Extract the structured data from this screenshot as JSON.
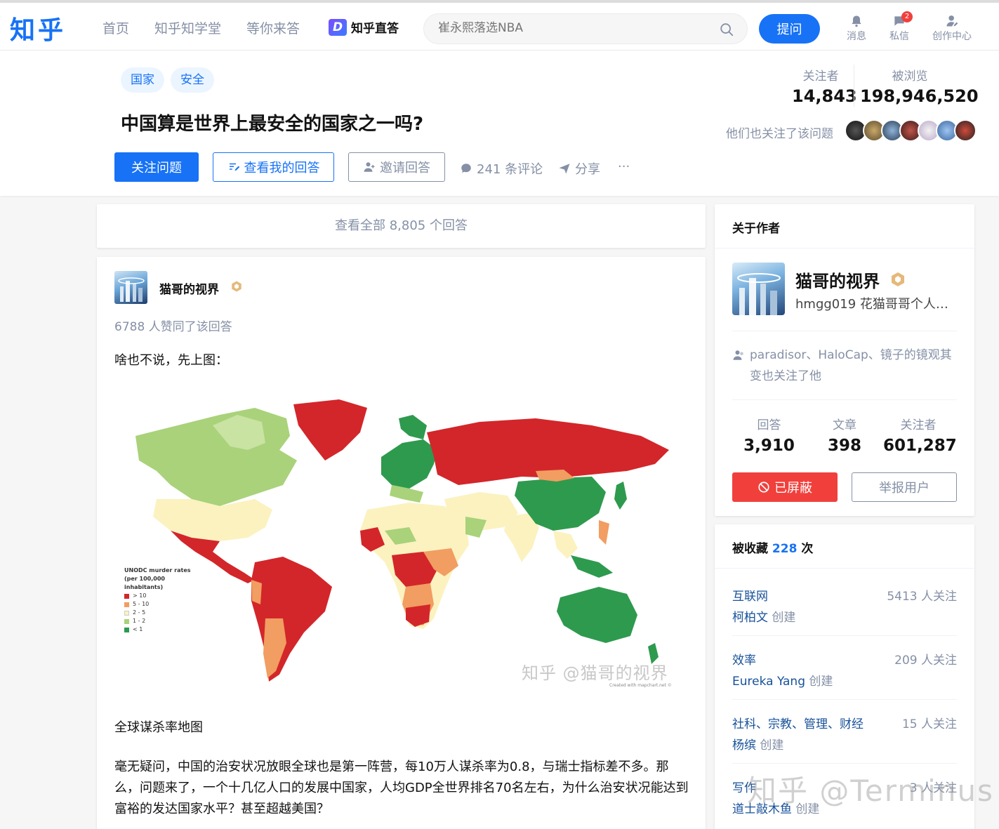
{
  "header": {
    "logo": "知乎",
    "nav": [
      "首页",
      "知乎知学堂",
      "等你来答"
    ],
    "zhida_icon": "D",
    "zhida_label": "知乎直答",
    "search_placeholder": "崔永熙落选NBA",
    "ask_label": "提问",
    "icons": [
      {
        "label": "消息",
        "icon": "bell-icon"
      },
      {
        "label": "私信",
        "icon": "chat-icon",
        "badge": "2"
      },
      {
        "label": "创作中心",
        "icon": "creator-icon"
      }
    ]
  },
  "question": {
    "tags": [
      "国家",
      "安全"
    ],
    "title": "中国算是世界上最安全的国家之一吗?",
    "follow_label": "关注问题",
    "my_answer_label": "查看我的回答",
    "invite_label": "邀请回答",
    "comments_label": "241 条评论",
    "share_label": "分享",
    "more_label": "···",
    "followers_label": "关注者",
    "followers_value": "14,843",
    "views_label": "被浏览",
    "views_value": "198,946,520",
    "also_follow_label": "他们也关注了该问题"
  },
  "main": {
    "view_all_label": "查看全部 8,805 个回答",
    "answer": {
      "author_name": "猫哥的视界",
      "votes": "6788 人赞同了该回答",
      "intro": "啥也不说，先上图：",
      "map_watermark": "知乎 @猫哥的视界",
      "map_credit": "Created with mapchart.net ©",
      "legend_title": "UNODC murder rates (per 100,000 inhabitants)",
      "legend": [
        {
          "label": "> 10",
          "color": "#d3262a"
        },
        {
          "label": "5 - 10",
          "color": "#f29d61"
        },
        {
          "label": "2 - 5",
          "color": "#fbf2c0"
        },
        {
          "label": "1 - 2",
          "color": "#a9d27a"
        },
        {
          "label": "< 1",
          "color": "#2e9a4e"
        }
      ],
      "caption": "全球谋杀率地图",
      "body": "毫无疑问，中国的治安状况放眼全球也是第一阵营，每10万人谋杀率为0.8，与瑞士指标差不多。那么，问题来了，一个十几亿人口的发展中国家，人均GDP全世界排名70名左右，为什么治安状况能达到富裕的发达国家水平？甚至超越美国？"
    }
  },
  "sidebar": {
    "about_title": "关于作者",
    "author_name": "猫哥的视界",
    "author_bio": "hmgg019 花猫哥哥个人好...",
    "also_follow": "paradisor、HaloCap、镜子的镜观其变也关注了他",
    "stats": [
      {
        "label": "回答",
        "value": "3,910"
      },
      {
        "label": "文章",
        "value": "398"
      },
      {
        "label": "关注者",
        "value": "601,287"
      }
    ],
    "blocked_label": "已屏蔽",
    "report_label": "举报用户",
    "collected_prefix": "被收藏",
    "collected_count": "228",
    "collected_suffix": "次",
    "collections": [
      {
        "name": "互联网",
        "count": "5413 人关注",
        "creator": "柯柏文",
        "suffix": "创建"
      },
      {
        "name": "效率",
        "count": "209 人关注",
        "creator": "Eureka Yang",
        "suffix": "创建"
      },
      {
        "name": "社科、宗教、管理、财经",
        "count": "15 人关注",
        "creator": "杨缤",
        "suffix": "创建"
      },
      {
        "name": "写作",
        "count": "3 人关注",
        "creator": "道士敲木鱼",
        "suffix": "创建"
      }
    ]
  },
  "watermark": "知乎 @Terminus",
  "colors": {
    "brand": "#1772f6",
    "danger": "#f1403c",
    "muted": "#8590a6"
  }
}
